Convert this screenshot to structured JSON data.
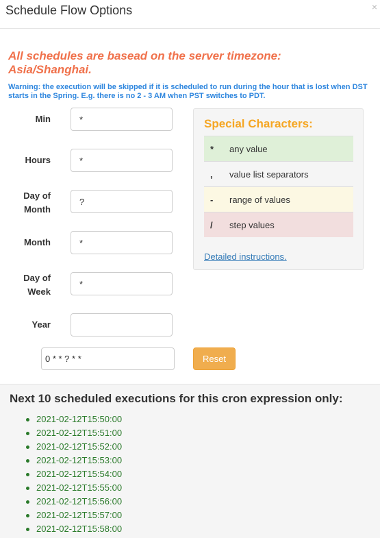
{
  "dialog": {
    "title": "Schedule Flow Options",
    "close_icon": "×"
  },
  "timezone_notice": "All schedules are basead on the server timezone: Asia/Shanghai.",
  "dst_warning": "Warning: the execution will be skipped if it is scheduled to run during the hour that is lost when DST starts in the Spring. E.g. there is no 2 - 3 AM when PST switches to PDT.",
  "fields": {
    "min": {
      "label": "Min",
      "value": "*"
    },
    "hours": {
      "label": "Hours",
      "value": "*"
    },
    "day_of_month": {
      "label": "Day of Month",
      "value": "?"
    },
    "month": {
      "label": "Month",
      "value": "*"
    },
    "day_of_week": {
      "label": "Day of Week",
      "value": "*"
    },
    "year": {
      "label": "Year",
      "value": ""
    }
  },
  "cron_expression": "0 * * ? * *",
  "reset_label": "Reset",
  "special_characters": {
    "title": "Special Characters:",
    "rows": [
      {
        "symbol": "*",
        "description": "any value"
      },
      {
        "symbol": ",",
        "description": "value list separators"
      },
      {
        "symbol": "-",
        "description": "range of values"
      },
      {
        "symbol": "/",
        "description": "step values"
      }
    ],
    "instructions_link": "Detailed instructions",
    "instructions_suffix": "."
  },
  "next_executions": {
    "title": "Next 10 scheduled executions for this cron expression only:",
    "items": [
      "2021-02-12T15:50:00",
      "2021-02-12T15:51:00",
      "2021-02-12T15:52:00",
      "2021-02-12T15:53:00",
      "2021-02-12T15:54:00",
      "2021-02-12T15:55:00",
      "2021-02-12T15:56:00",
      "2021-02-12T15:57:00",
      "2021-02-12T15:58:00"
    ]
  },
  "colors": {
    "notice": "#f0714b",
    "warning": "#2e86de",
    "special_title": "#f5a623",
    "reset_button": "#f0ad4e",
    "execution_text": "#2a7a2a"
  }
}
